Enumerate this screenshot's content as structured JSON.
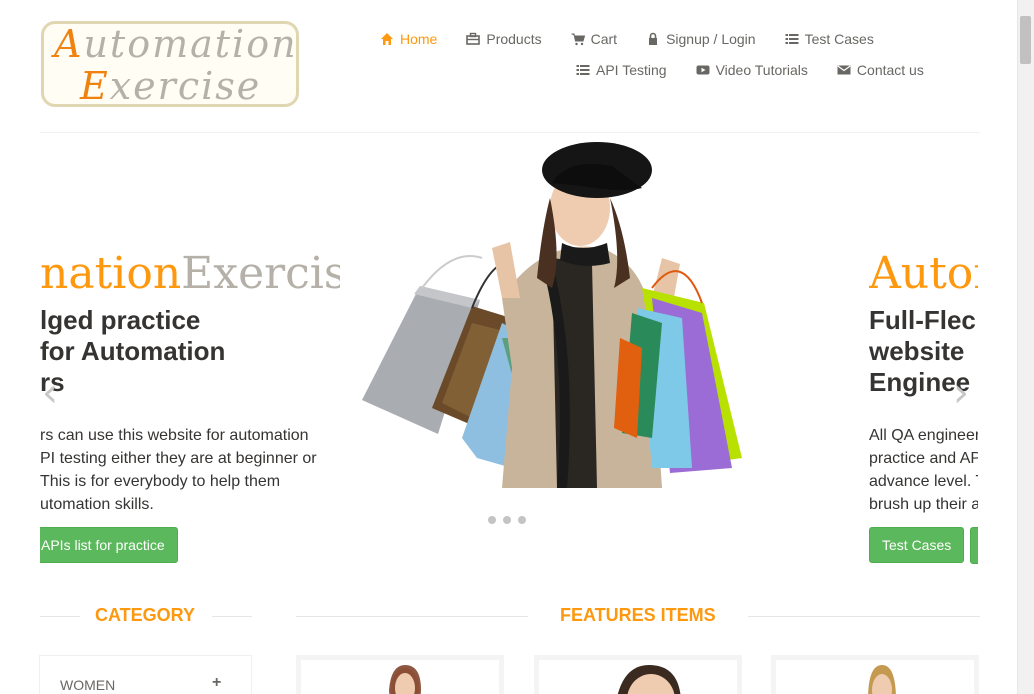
{
  "logo": {
    "line1_cap": "A",
    "line1_rest": "utomation",
    "line2_cap": "E",
    "line2_rest": "xercise"
  },
  "nav": {
    "row1": [
      {
        "label": "Home",
        "icon": "home-icon",
        "active": true
      },
      {
        "label": "Products",
        "icon": "products-icon"
      },
      {
        "label": "Cart",
        "icon": "cart-icon"
      },
      {
        "label": "Signup / Login",
        "icon": "lock-icon"
      },
      {
        "label": "Test Cases",
        "icon": "list-icon"
      }
    ],
    "row2": [
      {
        "label": "API Testing",
        "icon": "list-icon"
      },
      {
        "label": "Video Tutorials",
        "icon": "youtube-icon"
      },
      {
        "label": "Contact us",
        "icon": "envelope-icon"
      }
    ]
  },
  "slider": {
    "left": {
      "title_orange": "nationExercise",
      "title_orange_part": "nation",
      "title_gray_part": "Exercise",
      "heading_lines": [
        "lged practice",
        "for Automation",
        "rs"
      ],
      "desc_lines": [
        "rs can use this website for automation",
        "PI testing either they are at beginner or",
        "This is for everybody to help them",
        "utomation skills."
      ],
      "button": "APIs list for practice"
    },
    "right": {
      "title_orange": "Autor",
      "heading_lines": [
        "Full-Flec",
        "website",
        "Enginee"
      ],
      "desc_lines": [
        "All QA engineer",
        "practice and AP",
        "advance level. T",
        "brush up their a"
      ],
      "button": "Test Cases",
      "button2": ""
    },
    "prev_arrow": "‹",
    "next_arrow": "›",
    "dots": 3
  },
  "category": {
    "title": "CATEGORY",
    "items": [
      {
        "label": "WOMEN",
        "toggle": "+"
      }
    ]
  },
  "features": {
    "title": "FEATURES ITEMS"
  },
  "colors": {
    "accent": "#FE980F",
    "green": "#5CB85C",
    "text": "#696763",
    "dark": "#363432"
  }
}
